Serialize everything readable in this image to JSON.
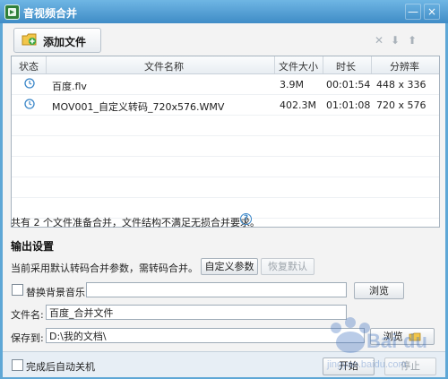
{
  "window": {
    "title": "音视频合并",
    "controls": [
      "—",
      "×"
    ]
  },
  "toolbar": {
    "add_label": "添加文件",
    "icons": [
      "delete-icon",
      "move-down-icon",
      "move-up-icon"
    ]
  },
  "table": {
    "columns": [
      "状态",
      "文件名称",
      "文件大小",
      "时长",
      "分辨率"
    ],
    "rows": [
      {
        "status_icon": "clock-icon",
        "name": "百度.flv",
        "size": "3.9M",
        "duration": "00:01:54",
        "resolution": "448 x 336"
      },
      {
        "status_icon": "clock-icon",
        "name": "MOV001_自定义转码_720x576.WMV",
        "size": "402.3M",
        "duration": "01:01:08",
        "resolution": "720 x 576"
      }
    ]
  },
  "note": "共有 2 个文件准备合并，文件结构不满足无损合并要求。",
  "output": {
    "section_title": "输出设置",
    "mode_text": "当前采用默认转码合并参数，需转码合并。",
    "custom_btn": "自定义参数",
    "restore_btn": "恢复默认",
    "bg_music_label": "替换背景音乐",
    "bg_music_value": "",
    "browse_label": "浏览",
    "filename_label": "文件名:",
    "filename_value": "百度_合并文件",
    "saveto_label": "保存到:",
    "saveto_value": "D:\\我的文档\\",
    "saveto_browse": "浏览"
  },
  "footer": {
    "auto_shutdown_label": "完成后自动关机",
    "start_label": "开始",
    "stop_label": "停止"
  },
  "watermark": {
    "text": "Baidu 经验",
    "sub": "jingyan.baidu.com"
  },
  "colors": {
    "titlebar": "#4f9ad3",
    "accent": "#3a86c8",
    "clock": "#3a86c8"
  }
}
